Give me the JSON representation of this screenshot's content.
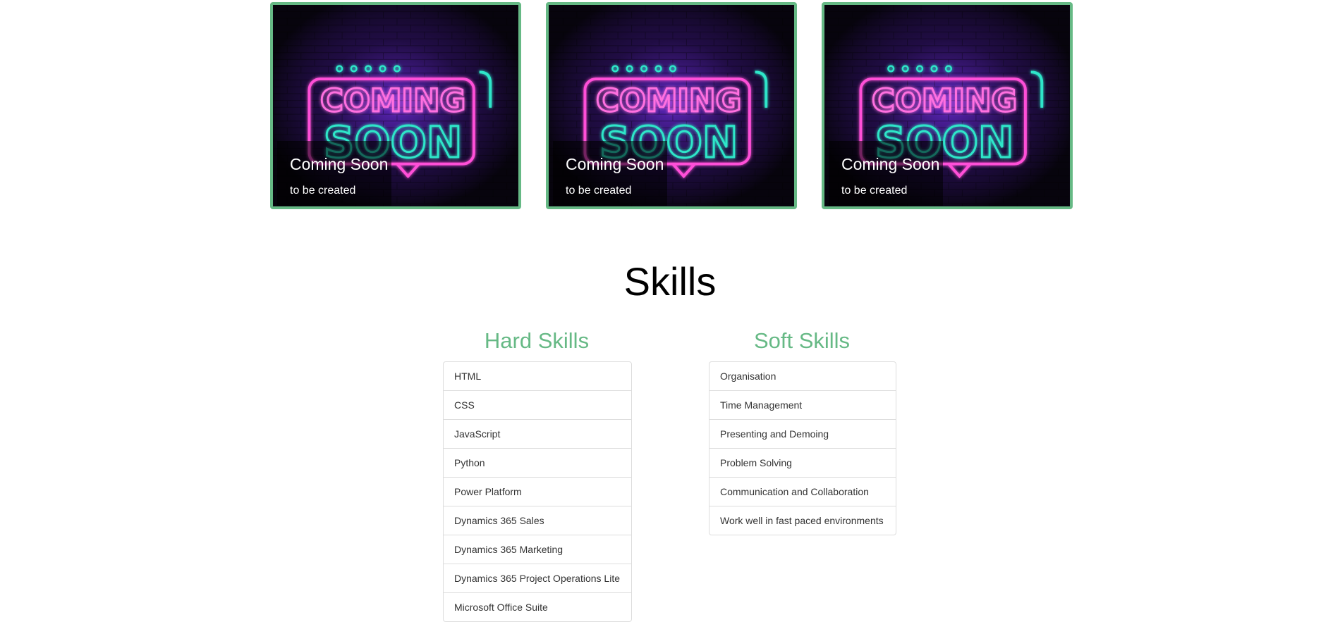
{
  "projects": [
    {
      "title": "Coming Soon",
      "subtitle": "to be created",
      "image_text": [
        "COMING",
        "SOON"
      ]
    },
    {
      "title": "Coming Soon",
      "subtitle": "to be created",
      "image_text": [
        "COMING",
        "SOON"
      ]
    },
    {
      "title": "Coming Soon",
      "subtitle": "to be created",
      "image_text": [
        "COMING",
        "SOON"
      ]
    }
  ],
  "skills": {
    "title": "Skills",
    "hard": {
      "title": "Hard Skills",
      "items": [
        "HTML",
        "CSS",
        "JavaScript",
        "Python",
        "Power Platform",
        "Dynamics 365 Sales",
        "Dynamics 365 Marketing",
        "Dynamics 365 Project Operations Lite",
        "Microsoft Office Suite"
      ]
    },
    "soft": {
      "title": "Soft Skills",
      "items": [
        "Organisation",
        "Time Management",
        "Presenting and Demoing",
        "Problem Solving",
        "Communication and Collaboration",
        "Work well in fast paced environments"
      ]
    }
  },
  "colors": {
    "accent": "#66b985",
    "neon_pink": "#ff4fd8",
    "neon_teal": "#2ee6c9",
    "neon_purple": "#7a2cff"
  }
}
